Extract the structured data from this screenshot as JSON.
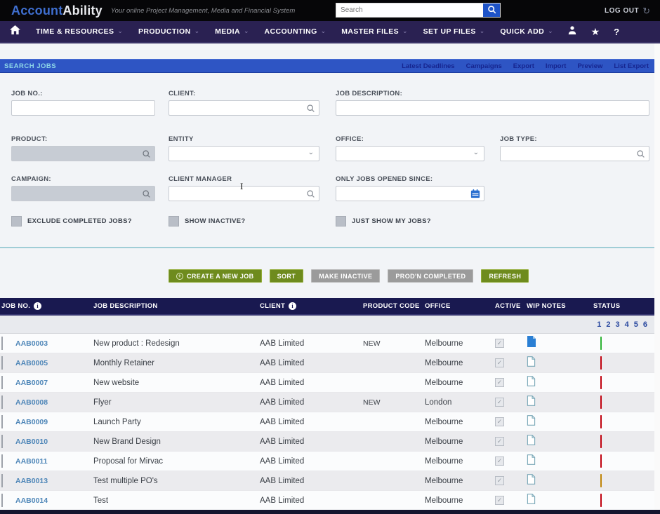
{
  "header": {
    "logo": {
      "part1": "Account",
      "part2": "Ability"
    },
    "tagline": "Your online Project Management, Media and Financial System",
    "search": {
      "placeholder": "Search"
    },
    "logout_label": "LOG OUT"
  },
  "nav": {
    "items": [
      {
        "label": "TIME & RESOURCES"
      },
      {
        "label": "PRODUCTION"
      },
      {
        "label": "MEDIA"
      },
      {
        "label": "ACCOUNTING"
      },
      {
        "label": "MASTER FILES"
      },
      {
        "label": "SET UP FILES"
      },
      {
        "label": "QUICK ADD"
      }
    ]
  },
  "titlebar": {
    "title": "SEARCH JOBS",
    "links": [
      "Latest Deadlines",
      "Campaigns",
      "Export",
      "Import",
      "Preview",
      "List Export"
    ]
  },
  "form": {
    "job_no_label": "JOB NO.:",
    "client_label": "CLIENT:",
    "job_description_label": "JOB DESCRIPTION:",
    "product_label": "PRODUCT:",
    "entity_label": "ENTITY",
    "office_label": "OFFICE:",
    "job_type_label": "JOB TYPE:",
    "campaign_label": "CAMPAIGN:",
    "client_manager_label": "CLIENT MANAGER",
    "opened_since_label": "ONLY JOBS OPENED SINCE:",
    "checkboxes": [
      {
        "label": "EXCLUDE COMPLETED JOBS?",
        "checked": false
      },
      {
        "label": "SHOW INACTIVE?",
        "checked": false
      },
      {
        "label": "JUST SHOW MY JOBS?",
        "checked": false
      }
    ]
  },
  "actions": {
    "create": "CREATE A NEW JOB",
    "sort": "SORT",
    "make_inactive": "MAKE INACTIVE",
    "prodn_completed": "PROD'N COMPLETED",
    "refresh": "REFRESH"
  },
  "table": {
    "columns": [
      "JOB NO.",
      "JOB DESCRIPTION",
      "CLIENT",
      "PRODUCT CODE",
      "OFFICE",
      "ACTIVE",
      "WIP NOTES",
      "STATUS"
    ],
    "pagination": [
      "1",
      "2",
      "3",
      "4",
      "5",
      "6"
    ],
    "rows": [
      {
        "job_no": "AAB0003",
        "description": "New product : Redesign",
        "client": "AAB Limited",
        "product_code": "NEW",
        "office": "Melbourne",
        "active": true,
        "wip_notes": "filled",
        "status": "green"
      },
      {
        "job_no": "AAB0005",
        "description": "Monthly Retainer",
        "client": "AAB Limited",
        "product_code": "",
        "office": "Melbourne",
        "active": true,
        "wip_notes": "outline",
        "status": "red"
      },
      {
        "job_no": "AAB0007",
        "description": "New website",
        "client": "AAB Limited",
        "product_code": "",
        "office": "Melbourne",
        "active": true,
        "wip_notes": "outline",
        "status": "red"
      },
      {
        "job_no": "AAB0008",
        "description": "Flyer",
        "client": "AAB Limited",
        "product_code": "NEW",
        "office": "London",
        "active": true,
        "wip_notes": "outline",
        "status": "red"
      },
      {
        "job_no": "AAB0009",
        "description": "Launch Party",
        "client": "AAB Limited",
        "product_code": "",
        "office": "Melbourne",
        "active": true,
        "wip_notes": "outline",
        "status": "red"
      },
      {
        "job_no": "AAB0010",
        "description": "New Brand Design",
        "client": "AAB Limited",
        "product_code": "",
        "office": "Melbourne",
        "active": true,
        "wip_notes": "outline",
        "status": "red"
      },
      {
        "job_no": "AAB0011",
        "description": "Proposal for Mirvac",
        "client": "AAB Limited",
        "product_code": "",
        "office": "Melbourne",
        "active": true,
        "wip_notes": "outline",
        "status": "red"
      },
      {
        "job_no": "AAB0013",
        "description": "Test multiple PO's",
        "client": "AAB Limited",
        "product_code": "",
        "office": "Melbourne",
        "active": true,
        "wip_notes": "outline",
        "status": "orange"
      },
      {
        "job_no": "AAB0014",
        "description": "Test",
        "client": "AAB Limited",
        "product_code": "",
        "office": "Melbourne",
        "active": true,
        "wip_notes": "outline",
        "status": "red"
      }
    ]
  },
  "colors": {
    "accent_olive": "#6e8b1d",
    "disabled_button_gray": "#9b9b9b",
    "status_green": "#3ecb44",
    "status_red": "#e30613",
    "status_orange": "#d8970e",
    "titlebar_blue": "#2e55c4",
    "nav_navy": "#2a2152",
    "table_header_navy": "#191950",
    "job_link_blue": "#4e86b8"
  }
}
